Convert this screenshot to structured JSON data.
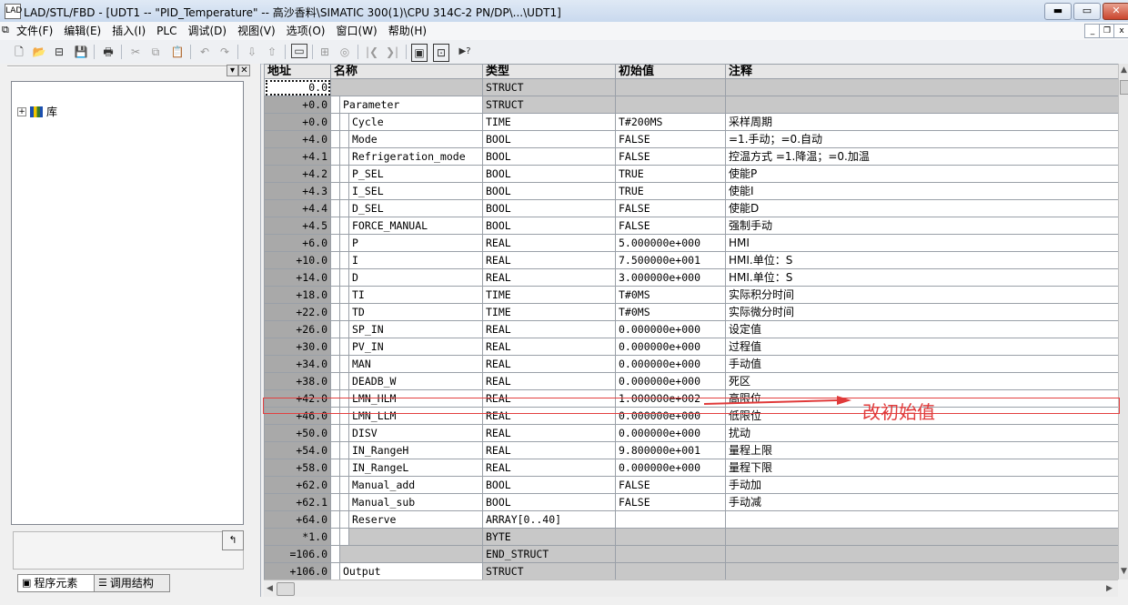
{
  "window": {
    "title": "LAD/STL/FBD  - [UDT1 -- \"PID_Temperature\" -- 高沙香料\\SIMATIC 300(1)\\CPU 314C-2 PN/DP\\...\\UDT1]",
    "app_icon_text": "LAD",
    "btn_minimize": "▬",
    "btn_restore": "▭",
    "btn_close": "✕",
    "mdi_minimize": "_",
    "mdi_restore": "❐",
    "mdi_close": "x"
  },
  "menu": [
    "文件(F)",
    "编辑(E)",
    "插入(I)",
    "PLC",
    "调试(D)",
    "视图(V)",
    "选项(O)",
    "窗口(W)",
    "帮助(H)"
  ],
  "toolbar": {
    "new": "🗋",
    "open": "📂",
    "network": "⊟",
    "save": "💾",
    "print": "🖶",
    "cut": "✂",
    "copy": "⧉",
    "paste": "📋",
    "undo": "↶",
    "redo": "↷",
    "download": "⇩",
    "upload": "⇧",
    "monitor": "▭",
    "module": "⊞",
    "glasses": "◎",
    "prev": "|❮",
    "next": "❯|",
    "overview": "▣",
    "detail": "⊡",
    "help": "▶?"
  },
  "left_panel": {
    "min_label": "▾",
    "close_label": "✕",
    "tree_expander": "+",
    "tree_item": "库",
    "small_button": "↰",
    "tab_program_elements": "程序元素",
    "tab_call_structure": "调用结构",
    "tab_icon_program": "▣",
    "tab_icon_call": "☰"
  },
  "grid": {
    "headers": [
      "地址",
      "名称",
      "类型",
      "初始值",
      "注释"
    ],
    "rows": [
      {
        "addr": "0.0",
        "name": "",
        "indent": 0,
        "type": "STRUCT",
        "init": "",
        "comment": "",
        "gray": true,
        "sel": true
      },
      {
        "addr": "+0.0",
        "name": "Parameter",
        "indent": 1,
        "type": "STRUCT",
        "init": "",
        "comment": "",
        "gray": true
      },
      {
        "addr": "+0.0",
        "name": "Cycle",
        "indent": 2,
        "type": "TIME",
        "init": "T#200MS",
        "comment": "采样周期"
      },
      {
        "addr": "+4.0",
        "name": "Mode",
        "indent": 2,
        "type": "BOOL",
        "init": "FALSE",
        "comment": "=1.手动；=0.自动"
      },
      {
        "addr": "+4.1",
        "name": "Refrigeration_mode",
        "indent": 2,
        "type": "BOOL",
        "init": "FALSE",
        "comment": "控温方式 =1.降温；=0.加温"
      },
      {
        "addr": "+4.2",
        "name": "P_SEL",
        "indent": 2,
        "type": "BOOL",
        "init": "TRUE",
        "comment": "使能P"
      },
      {
        "addr": "+4.3",
        "name": "I_SEL",
        "indent": 2,
        "type": "BOOL",
        "init": "TRUE",
        "comment": "使能I"
      },
      {
        "addr": "+4.4",
        "name": "D_SEL",
        "indent": 2,
        "type": "BOOL",
        "init": "FALSE",
        "comment": "使能D"
      },
      {
        "addr": "+4.5",
        "name": "FORCE_MANUAL",
        "indent": 2,
        "type": "BOOL",
        "init": "FALSE",
        "comment": "强制手动"
      },
      {
        "addr": "+6.0",
        "name": "P",
        "indent": 2,
        "type": "REAL",
        "init": "5.000000e+000",
        "comment": "HMI"
      },
      {
        "addr": "+10.0",
        "name": "I",
        "indent": 2,
        "type": "REAL",
        "init": "7.500000e+001",
        "comment": "HMI.单位：S"
      },
      {
        "addr": "+14.0",
        "name": "D",
        "indent": 2,
        "type": "REAL",
        "init": "3.000000e+000",
        "comment": "HMI.单位：S"
      },
      {
        "addr": "+18.0",
        "name": "TI",
        "indent": 2,
        "type": "TIME",
        "init": "T#0MS",
        "comment": "实际积分时间"
      },
      {
        "addr": "+22.0",
        "name": "TD",
        "indent": 2,
        "type": "TIME",
        "init": "T#0MS",
        "comment": "实际微分时间"
      },
      {
        "addr": "+26.0",
        "name": "SP_IN",
        "indent": 2,
        "type": "REAL",
        "init": "0.000000e+000",
        "comment": "设定值"
      },
      {
        "addr": "+30.0",
        "name": "PV_IN",
        "indent": 2,
        "type": "REAL",
        "init": "0.000000e+000",
        "comment": "过程值"
      },
      {
        "addr": "+34.0",
        "name": "MAN",
        "indent": 2,
        "type": "REAL",
        "init": "0.000000e+000",
        "comment": "手动值"
      },
      {
        "addr": "+38.0",
        "name": "DEADB_W",
        "indent": 2,
        "type": "REAL",
        "init": "0.000000e+000",
        "comment": "死区"
      },
      {
        "addr": "+42.0",
        "name": "LMN_HLM",
        "indent": 2,
        "type": "REAL",
        "init": "1.000000e+002",
        "comment": "高限位"
      },
      {
        "addr": "+46.0",
        "name": "LMN_LLM",
        "indent": 2,
        "type": "REAL",
        "init": "0.000000e+000",
        "comment": "低限位"
      },
      {
        "addr": "+50.0",
        "name": "DISV",
        "indent": 2,
        "type": "REAL",
        "init": "0.000000e+000",
        "comment": "扰动"
      },
      {
        "addr": "+54.0",
        "name": "IN_RangeH",
        "indent": 2,
        "type": "REAL",
        "init": "9.800000e+001",
        "comment": "量程上限"
      },
      {
        "addr": "+58.0",
        "name": "IN_RangeL",
        "indent": 2,
        "type": "REAL",
        "init": "0.000000e+000",
        "comment": "量程下限"
      },
      {
        "addr": "+62.0",
        "name": "Manual_add",
        "indent": 2,
        "type": "BOOL",
        "init": "FALSE",
        "comment": "手动加"
      },
      {
        "addr": "+62.1",
        "name": "Manual_sub",
        "indent": 2,
        "type": "BOOL",
        "init": "FALSE",
        "comment": "手动减"
      },
      {
        "addr": "+64.0",
        "name": "Reserve",
        "indent": 2,
        "type": "ARRAY[0..40]",
        "init": "",
        "comment": ""
      },
      {
        "addr": "*1.0",
        "name": "",
        "indent": 2,
        "type": "BYTE",
        "init": "",
        "comment": "",
        "gray": true
      },
      {
        "addr": "=106.0",
        "name": "",
        "indent": 1,
        "type": "END_STRUCT",
        "init": "",
        "comment": "",
        "gray": true
      },
      {
        "addr": "+106.0",
        "name": "Output",
        "indent": 1,
        "type": "STRUCT",
        "init": "",
        "comment": "",
        "gray": true
      }
    ]
  },
  "annotation": {
    "text": "改初始值",
    "color": "#e03a3a"
  },
  "colors": {
    "address_bg": "#a9a9a9",
    "gray_cell": "#c8c8c8"
  }
}
